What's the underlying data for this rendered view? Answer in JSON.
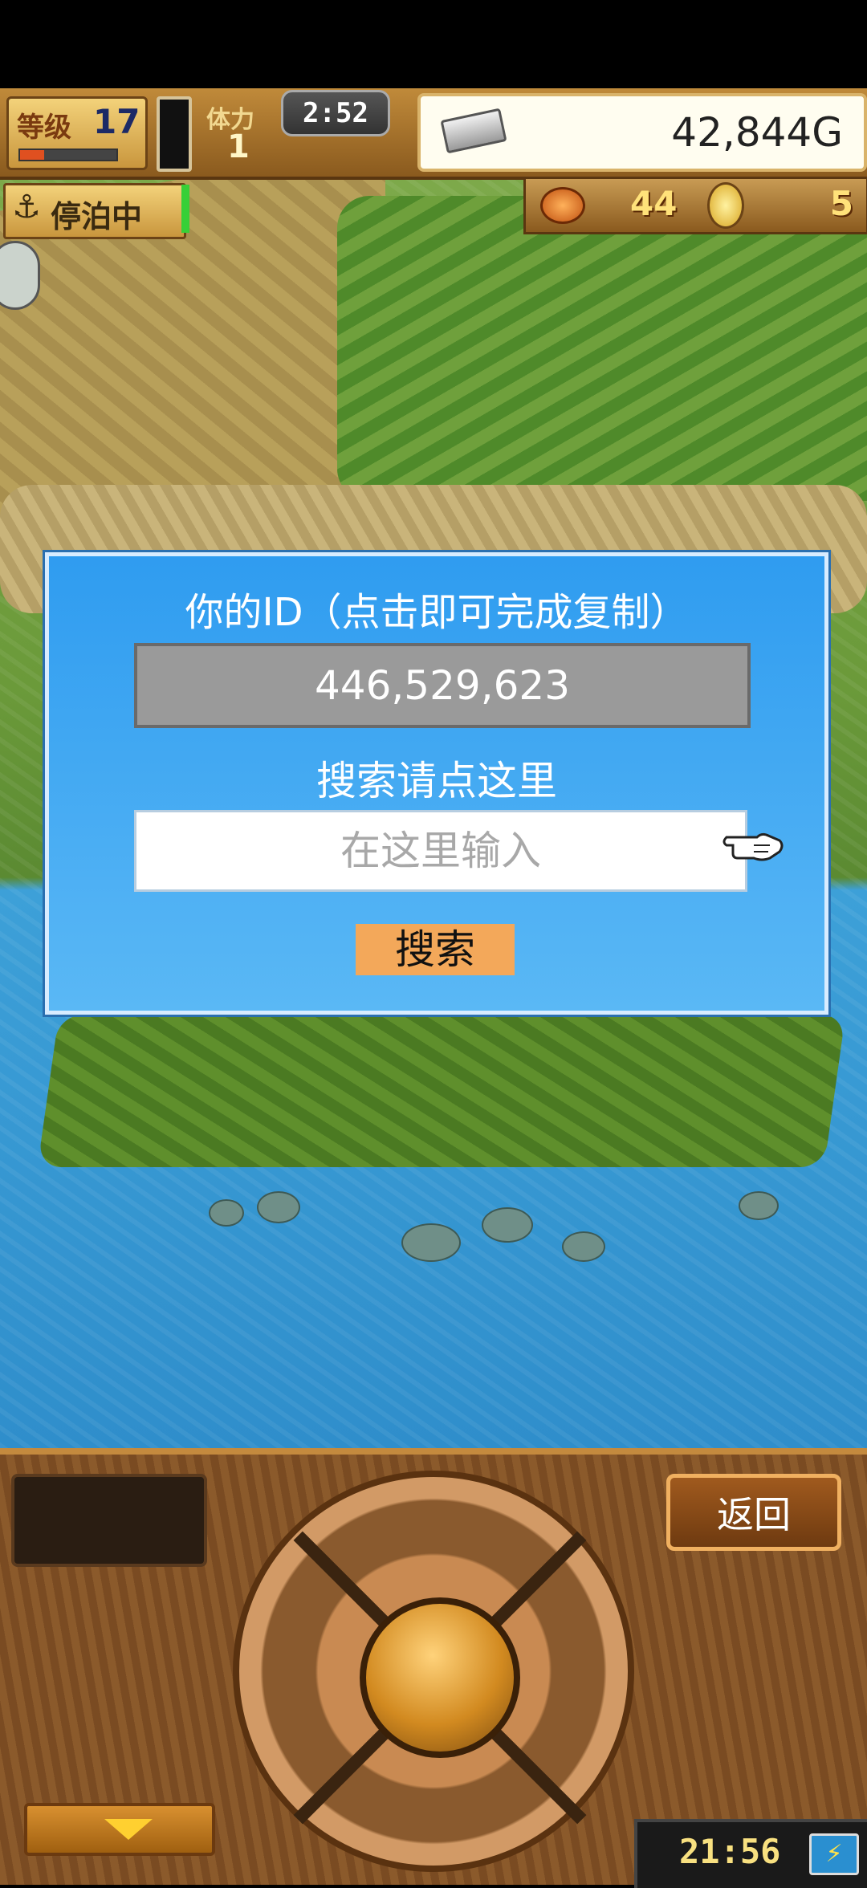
{
  "hud": {
    "level_label": "等级",
    "level": "17",
    "level_progress": 0.25,
    "stamina_label": "体力",
    "stamina": "1",
    "timer": "2:52",
    "gold": "42,844G"
  },
  "status": {
    "anchor_icon": "anchor-icon",
    "anchor_label": "停泊中",
    "resource_1": "44",
    "resource_2": "5"
  },
  "dialog": {
    "id_title": "你的ID（点击即可完成复制）",
    "id_value": "446,529,623",
    "search_title": "搜索请点这里",
    "search_placeholder": "在这里输入",
    "search_value": "",
    "search_button": "搜索"
  },
  "controls": {
    "return_label": "返回",
    "clock": "21:56",
    "battery_icon": "⚡"
  },
  "colors": {
    "dialog_bg": "#2f9cf0",
    "search_button_bg": "#f3a85a",
    "id_box_bg": "#9a9a9a"
  }
}
